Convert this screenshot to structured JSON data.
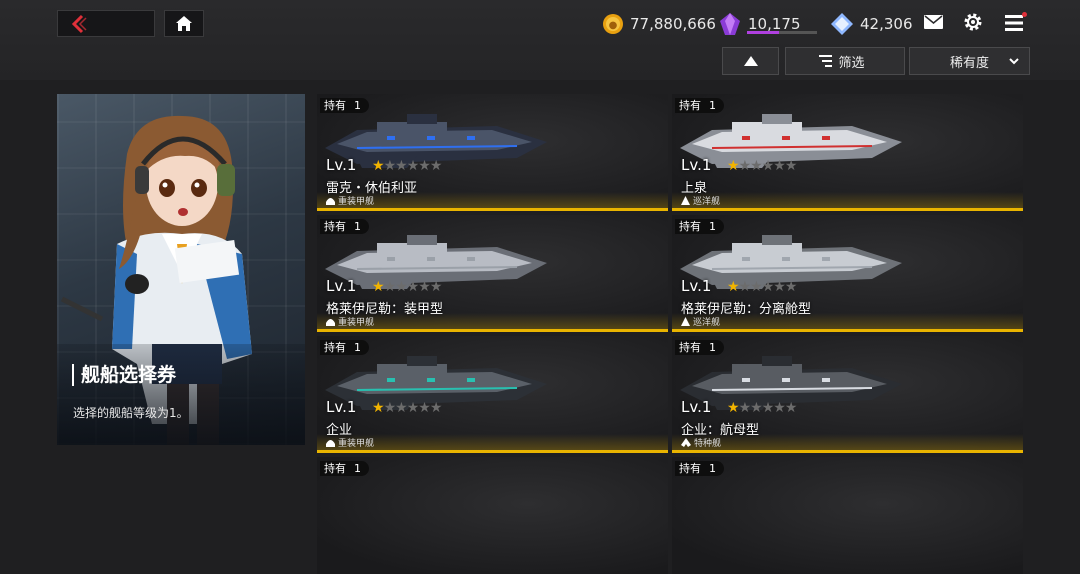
{
  "header": {
    "currencies": {
      "gold": "77,880,666",
      "crystal": "10,175",
      "crystal_progress": 0.45,
      "diamond": "42,306"
    },
    "filter_label": "筛选",
    "sort_label": "稀有度"
  },
  "ticket": {
    "title": "舰船选择券",
    "description": "选择的舰船等级为1。"
  },
  "owned_label": "持有",
  "cards": [
    {
      "owned": "1",
      "level": "Lv.1",
      "stars": 1,
      "max_stars": 6,
      "name": "雷克・休伯利亚",
      "type": "重装甲舰",
      "type_icon": "heavy-armor-icon"
    },
    {
      "owned": "1",
      "level": "Lv.1",
      "stars": 1,
      "max_stars": 6,
      "name": "上泉",
      "type": "巡洋舰",
      "type_icon": "cruiser-icon"
    },
    {
      "owned": "1",
      "level": "Lv.1",
      "stars": 1,
      "max_stars": 6,
      "name": "格莱伊尼勒：装甲型",
      "type": "重装甲舰",
      "type_icon": "heavy-armor-icon"
    },
    {
      "owned": "1",
      "level": "Lv.1",
      "stars": 1,
      "max_stars": 6,
      "name": "格莱伊尼勒：分离舱型",
      "type": "巡洋舰",
      "type_icon": "cruiser-icon"
    },
    {
      "owned": "1",
      "level": "Lv.1",
      "stars": 1,
      "max_stars": 6,
      "name": "企业",
      "type": "重装甲舰",
      "type_icon": "heavy-armor-icon"
    },
    {
      "owned": "1",
      "level": "Lv.1",
      "stars": 1,
      "max_stars": 6,
      "name": "企业：航母型",
      "type": "特种舰",
      "type_icon": "special-ship-icon"
    },
    {
      "owned": "1",
      "level": "",
      "stars": 0,
      "max_stars": 0,
      "name": "",
      "type": "",
      "type_icon": ""
    },
    {
      "owned": "1",
      "level": "",
      "stars": 0,
      "max_stars": 0,
      "name": "",
      "type": "",
      "type_icon": ""
    }
  ]
}
